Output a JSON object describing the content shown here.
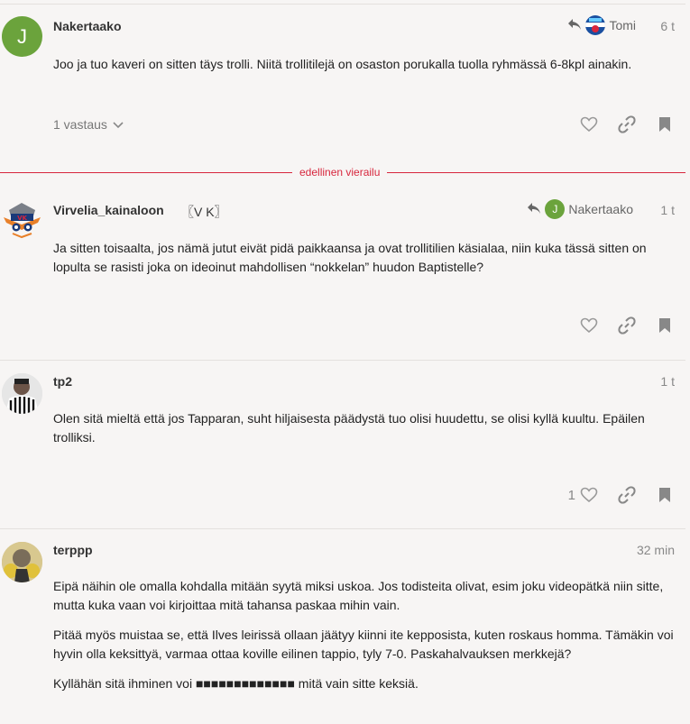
{
  "posts": [
    {
      "username": "Nakertaako",
      "avatar_letter": "J",
      "reply_to": "Tomi",
      "time": "6 t",
      "body": [
        "Joo ja tuo kaveri on sitten täys trolli. Niitä trollitilejä on osaston porukalla tuolla ryhmässä 6-8kpl ainakin."
      ],
      "replies_label": "1 vastaus"
    },
    {
      "username": "Virvelia_kainaloon",
      "flair": "〖V K〗",
      "reply_to": "Nakertaako",
      "reply_to_letter": "J",
      "time": "1 t",
      "body": [
        "Ja sitten toisaalta, jos nämä jutut eivät pidä paikkaansa ja ovat trollitilien käsialaa, niin kuka tässä sitten on lopulta se rasisti joka on ideoinut mahdollisen “nokkelan” huudon Baptistelle?"
      ]
    },
    {
      "username": "tp2",
      "time": "1 t",
      "body": [
        "Olen sitä mieltä että jos Tapparan, suht hiljaisesta päädystä tuo olisi huudettu, se olisi kyllä kuultu. Epäilen trolliksi."
      ],
      "like_count": "1"
    },
    {
      "username": "terppp",
      "time": "32 min",
      "body": [
        "Eipä näihin ole omalla kohdalla mitään syytä miksi uskoa. Jos todisteita olivat, esim joku videopätkä niin sitte, mutta kuka vaan voi kirjoittaa mitä tahansa paskaa mihin vain.",
        "Pitää myös muistaa se, että Ilves leirissä ollaan jäätyy kiinni ite kepposista, kuten roskaus homma. Tämäkin voi hyvin olla keksittyä, varmaa ottaa koville eilinen tappio, tyly 7-0. Paskahalvauksen merkkejä?",
        "Kyllähän sitä ihminen voi ■■■■■■■■■■■■■ mitä vain sitte keksiä."
      ]
    }
  ],
  "divider_label": "edellinen vierailu",
  "colors": {
    "accent": "#d7263d",
    "avatar_green": "#6ba33c",
    "background": "#f7f5f4"
  }
}
